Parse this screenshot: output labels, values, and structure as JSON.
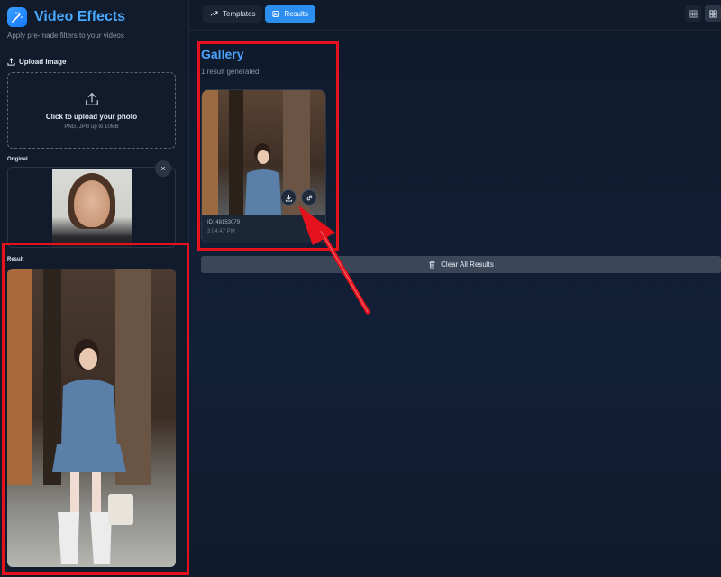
{
  "brand": {
    "title": "Video Effects",
    "subtitle": "Apply pre-made filters to your videos",
    "icon": "magic-wand-icon"
  },
  "upload": {
    "label": "Upload Image",
    "title": "Click to upload your photo",
    "hint": "PNG, JPG up to 10MB",
    "icon": "upload-icon"
  },
  "original": {
    "label": "Original",
    "close": "×"
  },
  "result": {
    "label": "Result"
  },
  "tabs": [
    {
      "label": "Templates",
      "icon": "trend-icon",
      "active": false
    },
    {
      "label": "Results",
      "icon": "image-icon",
      "active": true
    }
  ],
  "gallery": {
    "title": "Gallery",
    "count": "1 result generated",
    "items": [
      {
        "id": "ID: 48153079",
        "time": "3:04:47 PM"
      }
    ]
  },
  "clear_button": {
    "label": "Clear All Results"
  },
  "colors": {
    "accent": "#2c8ff0",
    "brand": "#47a8ff",
    "highlight": "#e5111c"
  }
}
